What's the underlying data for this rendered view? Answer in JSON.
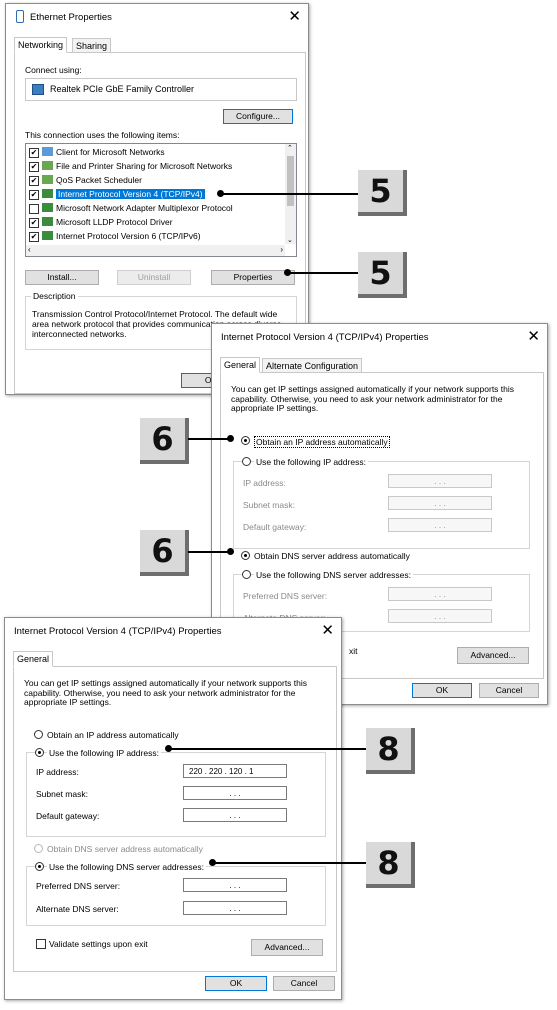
{
  "ethernet_dialog": {
    "title": "Ethernet Properties",
    "tabs": [
      "Networking",
      "Sharing"
    ],
    "connect_using_label": "Connect using:",
    "adapter_name": "Realtek PCIe GbE Family Controller",
    "configure_label": "Configure...",
    "items_label": "This connection uses the following items:",
    "items": [
      {
        "label": "Client for Microsoft Networks",
        "checked": true
      },
      {
        "label": "File and Printer Sharing for Microsoft Networks",
        "checked": true
      },
      {
        "label": "QoS Packet Scheduler",
        "checked": true
      },
      {
        "label": "Internet Protocol Version 4 (TCP/IPv4)",
        "checked": true,
        "selected": true
      },
      {
        "label": "Microsoft Network Adapter Multiplexor Protocol",
        "checked": false
      },
      {
        "label": "Microsoft LLDP Protocol Driver",
        "checked": true
      },
      {
        "label": "Internet Protocol Version 6 (TCP/IPv6)",
        "checked": true
      }
    ],
    "install_label": "Install...",
    "uninstall_label": "Uninstall",
    "properties_label": "Properties",
    "description_heading": "Description",
    "description_text": "Transmission Control Protocol/Internet Protocol. The default wide area network protocol that provides communication across diverse interconnected networks.",
    "ok_label": "OK"
  },
  "ipv4_dialog_auto": {
    "title": "Internet Protocol Version 4 (TCP/IPv4) Properties",
    "tabs": [
      "General",
      "Alternate Configuration"
    ],
    "intro": "You can get IP settings assigned automatically if your network supports this capability. Otherwise, you need to ask your network administrator for the appropriate IP settings.",
    "obtain_ip_auto": "Obtain an IP address automatically",
    "use_following_ip": "Use the following IP address:",
    "ip_address_label": "IP address:",
    "subnet_mask_label": "Subnet mask:",
    "default_gateway_label": "Default gateway:",
    "obtain_dns_auto": "Obtain DNS server address automatically",
    "use_following_dns": "Use the following DNS server addresses:",
    "preferred_dns_label": "Preferred DNS server:",
    "alternate_dns_label": "Alternate DNS server:",
    "partial_exit_text": "xit",
    "advanced_label": "Advanced...",
    "ok_label": "OK",
    "cancel_label": "Cancel",
    "empty_ip": ".   .   ."
  },
  "ipv4_dialog_manual": {
    "title": "Internet Protocol Version 4 (TCP/IPv4) Properties",
    "tabs": [
      "General"
    ],
    "intro": "You can get IP settings assigned automatically if your network supports this capability. Otherwise, you need to ask your network administrator for the appropriate IP settings.",
    "obtain_ip_auto": "Obtain an IP address automatically",
    "use_following_ip": "Use the following IP address:",
    "ip_address_label": "IP address:",
    "ip_address_value": "220 . 220 . 120 .  1",
    "subnet_mask_label": "Subnet mask:",
    "default_gateway_label": "Default gateway:",
    "obtain_dns_auto": "Obtain DNS server address automatically",
    "use_following_dns": "Use the following DNS server addresses:",
    "preferred_dns_label": "Preferred DNS server:",
    "alternate_dns_label": "Alternate DNS server:",
    "validate_label": "Validate settings upon exit",
    "advanced_label": "Advanced...",
    "ok_label": "OK",
    "cancel_label": "Cancel",
    "empty_ip": ".   .   ."
  },
  "callouts": [
    "5",
    "5",
    "6",
    "6",
    "8",
    "8"
  ]
}
